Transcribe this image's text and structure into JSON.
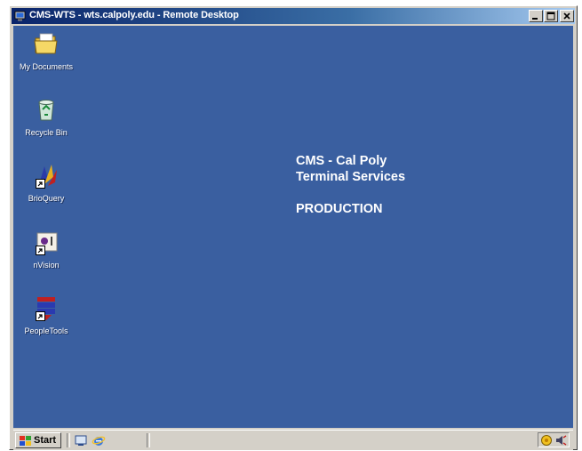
{
  "window": {
    "title": "CMS-WTS - wts.calpoly.edu - Remote Desktop"
  },
  "desktop": {
    "icons": [
      {
        "label": "My Documents",
        "icon": "my-documents-folder-icon"
      },
      {
        "label": "Recycle Bin",
        "icon": "recycle-bin-icon"
      },
      {
        "label": "BrioQuery",
        "icon": "brioquery-icon"
      },
      {
        "label": "nVision",
        "icon": "nvision-icon"
      },
      {
        "label": "PeopleTools",
        "icon": "peopletools-icon"
      }
    ],
    "banner": {
      "line1": "CMS - Cal Poly",
      "line2": "Terminal Services",
      "line3": "PRODUCTION"
    }
  },
  "taskbar": {
    "start_label": "Start",
    "quick_launch": [
      "show-desktop-icon",
      "internet-explorer-icon"
    ],
    "tray_icons": [
      "network-icon",
      "volume-icon"
    ]
  },
  "colors": {
    "desktop": "#3a5fa0",
    "titlebar_start": "#0a246a",
    "titlebar_end": "#a6caf0",
    "chrome": "#d4d0c8"
  }
}
